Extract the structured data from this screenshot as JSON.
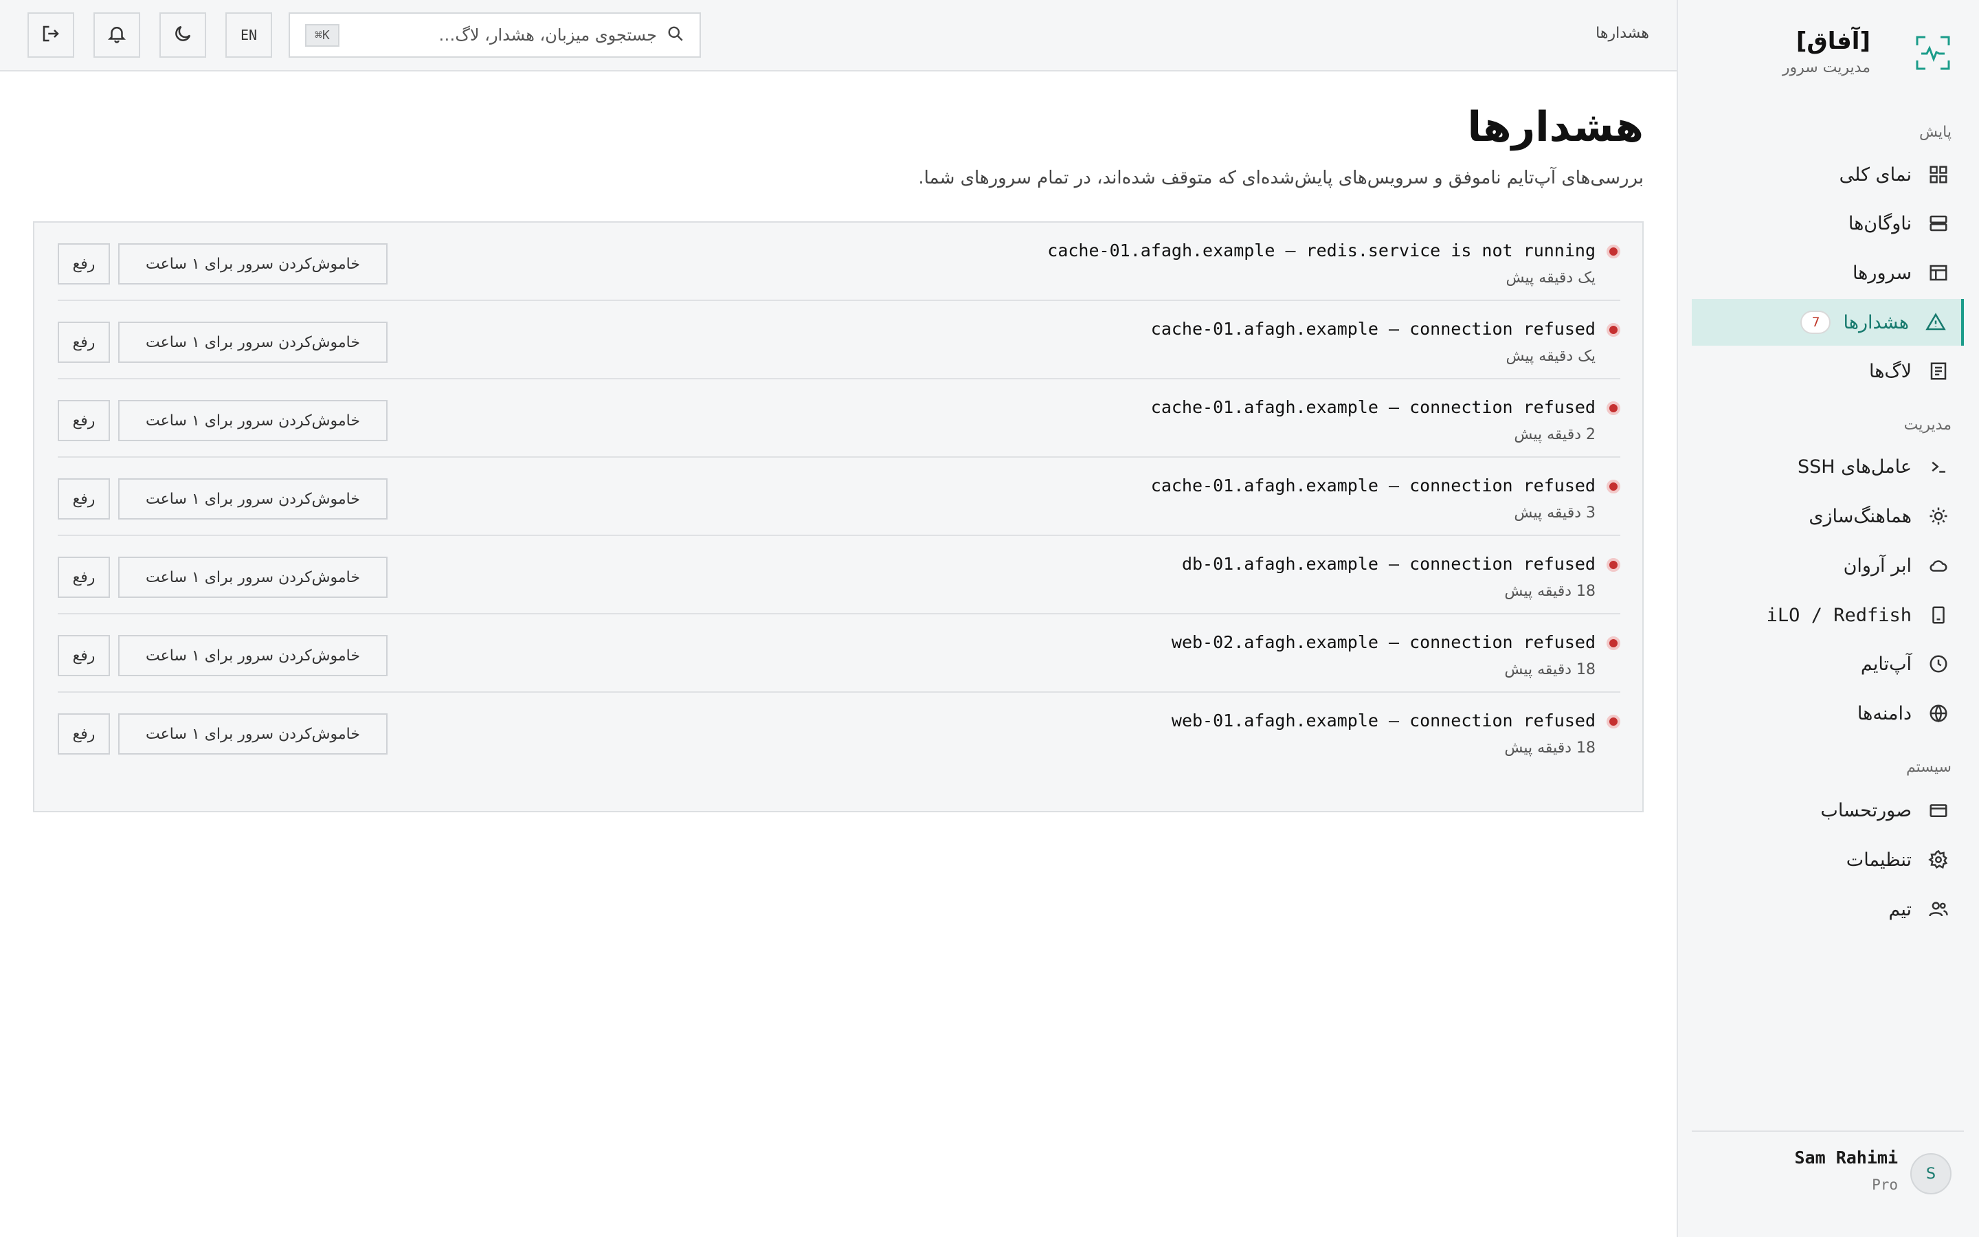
{
  "brand": {
    "name": "[آفاق]",
    "subtitle": "مدیریت سرور",
    "accent": "#1b9c8a"
  },
  "topbar": {
    "breadcrumb": "هشدارها",
    "search_placeholder": "جستجوی میزبان، هشدار، لاگ…",
    "search_shortcut": "⌘K",
    "lang_label": "EN",
    "icons": [
      "theme-moon-icon",
      "bell-icon",
      "logout-icon"
    ]
  },
  "sidebar": {
    "sections": [
      {
        "title": "پایش",
        "items": [
          {
            "label": "نمای کلی",
            "icon": "grid-icon"
          },
          {
            "label": "ناوگان‌ها",
            "icon": "server-stack-icon"
          },
          {
            "label": "سرورها",
            "icon": "table-icon"
          },
          {
            "label": "هشدارها",
            "icon": "warning-icon",
            "badge": "7",
            "active": true
          },
          {
            "label": "لاگ‌ها",
            "icon": "log-icon"
          }
        ]
      },
      {
        "title": "مدیریت",
        "items": [
          {
            "label": "عامل‌های SSH",
            "icon": "terminal-icon"
          },
          {
            "label": "هماهنگ‌سازی",
            "icon": "sun-icon"
          },
          {
            "label": "ابر آروان",
            "icon": "cloud-icon"
          },
          {
            "label": "iLO / Redfish",
            "icon": "device-icon"
          },
          {
            "label": "آپ‌تایم",
            "icon": "clock-icon"
          },
          {
            "label": "دامنه‌ها",
            "icon": "globe-icon"
          }
        ]
      },
      {
        "title": "سیستم",
        "items": [
          {
            "label": "صورتحساب",
            "icon": "card-icon"
          },
          {
            "label": "تنظیمات",
            "icon": "gear-icon"
          },
          {
            "label": "تیم",
            "icon": "users-icon"
          }
        ]
      }
    ]
  },
  "user": {
    "initial": "S",
    "name": "Sam Rahimi",
    "plan": "Pro"
  },
  "page": {
    "title": "هشدارها",
    "subtitle": "بررسی‌های آپ‌تایم ناموفق و سرویس‌های پایش‌شده‌ای که متوقف شده‌اند، در تمام سرورهای شما."
  },
  "alerts": [
    {
      "title": "cache-01.afagh.example — redis.service is not running",
      "time": "یک دقیقه پیش",
      "mute_label": "خاموش‌کردن سرور برای ۱ ساعت",
      "resolve_label": "رفع"
    },
    {
      "title": "cache-01.afagh.example — connection refused",
      "time": "یک دقیقه پیش",
      "mute_label": "خاموش‌کردن سرور برای ۱ ساعت",
      "resolve_label": "رفع"
    },
    {
      "title": "cache-01.afagh.example — connection refused",
      "time": "2 دقیقه پیش",
      "mute_label": "خاموش‌کردن سرور برای ۱ ساعت",
      "resolve_label": "رفع"
    },
    {
      "title": "cache-01.afagh.example — connection refused",
      "time": "3 دقیقه پیش",
      "mute_label": "خاموش‌کردن سرور برای ۱ ساعت",
      "resolve_label": "رفع"
    },
    {
      "title": "db-01.afagh.example — connection refused",
      "time": "18 دقیقه پیش",
      "mute_label": "خاموش‌کردن سرور برای ۱ ساعت",
      "resolve_label": "رفع"
    },
    {
      "title": "web-02.afagh.example — connection refused",
      "time": "18 دقیقه پیش",
      "mute_label": "خاموش‌کردن سرور برای ۱ ساعت",
      "resolve_label": "رفع"
    },
    {
      "title": "web-01.afagh.example — connection refused",
      "time": "18 دقیقه پیش",
      "mute_label": "خاموش‌کردن سرور برای ۱ ساعت",
      "resolve_label": "رفع"
    }
  ]
}
